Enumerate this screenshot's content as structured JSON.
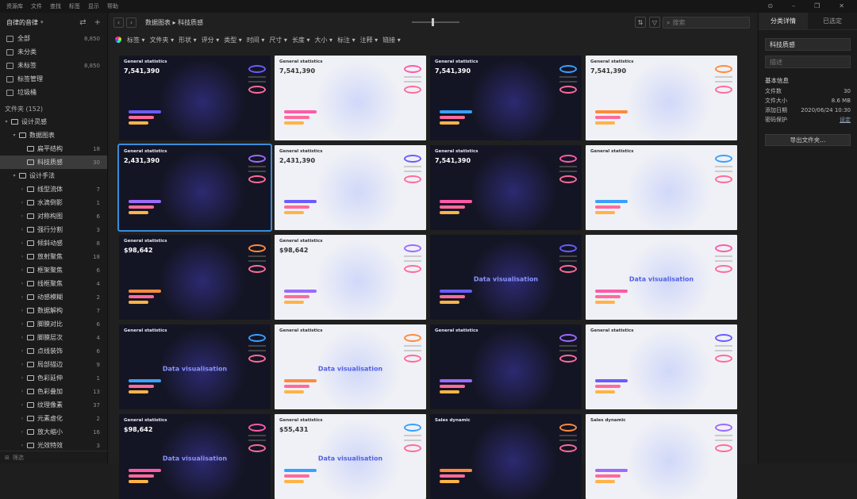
{
  "menu": [
    "资源库",
    "文件",
    "查找",
    "标签",
    "显示",
    "帮助"
  ],
  "sidebar": {
    "library_title": "自律的音律",
    "items": [
      {
        "label": "全部",
        "count": "8,850",
        "icon": "all-icon"
      },
      {
        "label": "未分类",
        "count": "",
        "icon": "unclassified-icon"
      },
      {
        "label": "未标签",
        "count": "8,850",
        "icon": "untagged-icon"
      },
      {
        "label": "标签管理",
        "count": "",
        "icon": "tag-manage-icon"
      },
      {
        "label": "垃圾桶",
        "count": "",
        "icon": "trash-icon"
      }
    ],
    "folders_header": "文件夹 (152)",
    "folders": [
      {
        "label": "设计灵感",
        "count": "",
        "level": 0,
        "twisty": "▾"
      },
      {
        "label": "数据图表",
        "count": "",
        "level": 1,
        "twisty": "▾"
      },
      {
        "label": "扁平结构",
        "count": "18",
        "level": 2,
        "twisty": ""
      },
      {
        "label": "科技质感",
        "count": "30",
        "level": 2,
        "twisty": "",
        "selected": true
      },
      {
        "label": "设计手法",
        "count": "",
        "level": 1,
        "twisty": "▾"
      },
      {
        "label": "线型流体",
        "count": "7",
        "level": 2,
        "twisty": "›"
      },
      {
        "label": "水滴倒影",
        "count": "1",
        "level": 2,
        "twisty": "›"
      },
      {
        "label": "对称构图",
        "count": "6",
        "level": 2,
        "twisty": "›"
      },
      {
        "label": "强行分割",
        "count": "3",
        "level": 2,
        "twisty": "›"
      },
      {
        "label": "倾斜动感",
        "count": "8",
        "level": 2,
        "twisty": "›"
      },
      {
        "label": "放射聚焦",
        "count": "18",
        "level": 2,
        "twisty": "›"
      },
      {
        "label": "框架聚焦",
        "count": "6",
        "level": 2,
        "twisty": "›"
      },
      {
        "label": "线框聚焦",
        "count": "4",
        "level": 2,
        "twisty": "›"
      },
      {
        "label": "动感模糊",
        "count": "2",
        "level": 2,
        "twisty": "›"
      },
      {
        "label": "数据解构",
        "count": "7",
        "level": 2,
        "twisty": "›"
      },
      {
        "label": "脚膜对比",
        "count": "6",
        "level": 2,
        "twisty": "›"
      },
      {
        "label": "脚膜层次",
        "count": "4",
        "level": 2,
        "twisty": "›"
      },
      {
        "label": "点线装饰",
        "count": "6",
        "level": 2,
        "twisty": "›"
      },
      {
        "label": "局部描边",
        "count": "9",
        "level": 2,
        "twisty": "›"
      },
      {
        "label": "色彩延伸",
        "count": "1",
        "level": 2,
        "twisty": "›"
      },
      {
        "label": "色彩叠加",
        "count": "13",
        "level": 2,
        "twisty": "›"
      },
      {
        "label": "纹理像素",
        "count": "37",
        "level": 2,
        "twisty": "›"
      },
      {
        "label": "元素虚化",
        "count": "2",
        "level": 2,
        "twisty": "›"
      },
      {
        "label": "放大缩小",
        "count": "16",
        "level": 2,
        "twisty": "›"
      },
      {
        "label": "光效特效",
        "count": "3",
        "level": 2,
        "twisty": "›"
      }
    ],
    "footer": "筛选"
  },
  "toolbar": {
    "back": "‹",
    "forward": "›",
    "breadcrumb": "数据图表 ▸ 科技质感",
    "search_placeholder": "搜索"
  },
  "filters": [
    "标签 ▾",
    "文件夹 ▾",
    "形状 ▾",
    "评分 ▾",
    "类型 ▾",
    "时间 ▾",
    "尺寸 ▾",
    "长度 ▾",
    "大小 ▾",
    "标注 ▾",
    "注释 ▾",
    "链接 ▾"
  ],
  "thumbnails": [
    {
      "theme": "dark",
      "title": "General statistics",
      "value": "7,541,390",
      "viz": ""
    },
    {
      "theme": "light",
      "title": "General statistics",
      "value": "7,541,390",
      "viz": ""
    },
    {
      "theme": "dark",
      "title": "General statistics",
      "value": "7,541,390",
      "viz": ""
    },
    {
      "theme": "light",
      "title": "General statistics",
      "value": "7,541,390",
      "viz": ""
    },
    {
      "theme": "dark",
      "title": "General statistics",
      "value": "2,431,390",
      "viz": ""
    },
    {
      "theme": "light",
      "title": "General statistics",
      "value": "2,431,390",
      "viz": ""
    },
    {
      "theme": "dark",
      "title": "General statistics",
      "value": "7,541,390",
      "viz": ""
    },
    {
      "theme": "light",
      "title": "General statistics",
      "value": "",
      "viz": ""
    },
    {
      "theme": "dark",
      "title": "General statistics",
      "value": "$98,642",
      "viz": ""
    },
    {
      "theme": "light",
      "title": "General statistics",
      "value": "$98,642",
      "viz": ""
    },
    {
      "theme": "dark",
      "title": "",
      "value": "",
      "viz": "Data visualisation"
    },
    {
      "theme": "light",
      "title": "",
      "value": "",
      "viz": "Data visualisation"
    },
    {
      "theme": "dark",
      "title": "General statistics",
      "value": "",
      "viz": "Data visualisation"
    },
    {
      "theme": "light",
      "title": "General statistics",
      "value": "",
      "viz": "Data visualisation"
    },
    {
      "theme": "dark",
      "title": "General statistics",
      "value": "",
      "viz": ""
    },
    {
      "theme": "light",
      "title": "General statistics",
      "value": "",
      "viz": ""
    },
    {
      "theme": "dark",
      "title": "General statistics",
      "value": "$98,642",
      "viz": "Data visualisation"
    },
    {
      "theme": "light",
      "title": "General statistics",
      "value": "$55,431",
      "viz": "Data visualisation"
    },
    {
      "theme": "dark",
      "title": "Sales dynamic",
      "value": "",
      "viz": ""
    },
    {
      "theme": "light",
      "title": "Sales dynamic",
      "value": "",
      "viz": ""
    }
  ],
  "rpanel": {
    "tabs": [
      "分类详情",
      "已选定"
    ],
    "name": "科技质感",
    "desc_placeholder": "描述",
    "info_title": "基本信息",
    "info": [
      {
        "k": "文件数",
        "v": "30",
        "link": false
      },
      {
        "k": "文件大小",
        "v": "8.6 MB",
        "link": false
      },
      {
        "k": "添加日期",
        "v": "2020/06/24 10:30",
        "link": false
      },
      {
        "k": "密码保护",
        "v": "设定",
        "link": true
      }
    ],
    "export_label": "导出文件夹..."
  }
}
